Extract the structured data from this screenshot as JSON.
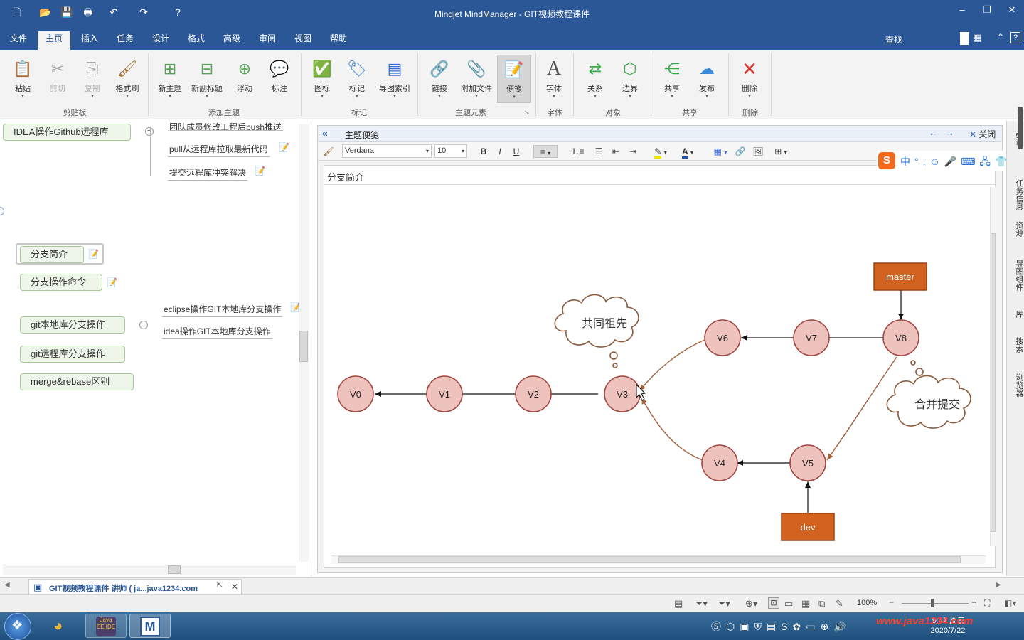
{
  "app": {
    "title": "Mindjet MindManager - GIT视频教程课件"
  },
  "menu": {
    "tabs": [
      "文件",
      "主页",
      "插入",
      "任务",
      "设计",
      "格式",
      "高级",
      "审阅",
      "视图",
      "帮助"
    ],
    "active": "主页",
    "find": "查找"
  },
  "ribbon": {
    "clipboard": {
      "paste": "粘贴",
      "cut": "剪切",
      "copy": "复制",
      "painter": "格式刷",
      "group": "剪贴板"
    },
    "add": {
      "new_topic": "新主题",
      "new_subtopic": "新副标题",
      "floating": "浮动",
      "callout": "标注",
      "group": "添加主题"
    },
    "markers": {
      "icon": "图标",
      "tag": "标记",
      "index": "导图索引",
      "group": "标记"
    },
    "elements": {
      "link": "链接",
      "attach": "附加文件",
      "notes": "便笺",
      "group": "主题元素"
    },
    "font": {
      "font": "字体",
      "group": "字体"
    },
    "objects": {
      "relation": "关系",
      "boundary": "边界",
      "group": "对象"
    },
    "share": {
      "share": "共享",
      "publish": "发布",
      "group": "共享"
    },
    "delete": {
      "delete": "删除",
      "group": "删除"
    }
  },
  "mindmap": {
    "root": "IDEA操作Github远程库",
    "root_children": [
      "团队成员修改工程后push推送",
      "pull从远程库拉取最新代码",
      "提交远程库冲突解决"
    ],
    "topics": [
      "分支简介",
      "分支操作命令",
      "git本地库分支操作",
      "git远程库分支操作",
      "merge&rebase区别"
    ],
    "local_children": [
      "eclipse操作GIT本地库分支操作",
      "idea操作GIT本地库分支操作"
    ]
  },
  "notes": {
    "header": "主题便笺",
    "close": "关闭",
    "font_name": "Verdana",
    "font_size": "10",
    "bold": "B",
    "italic": "I",
    "underline": "U",
    "body_title": "分支简介"
  },
  "diagram": {
    "nodes": [
      "V0",
      "V1",
      "V2",
      "V3",
      "V4",
      "V5",
      "V6",
      "V7",
      "V8"
    ],
    "branches": [
      "master",
      "dev"
    ],
    "clouds": [
      "共同祖先",
      "合并提交"
    ]
  },
  "dock": {
    "items": [
      "索引",
      "任务信息",
      "资源",
      "导图组件",
      "库",
      "搜索",
      "浏览器"
    ]
  },
  "doctab": {
    "label": "GIT视频教程课件 讲师 ( ja...java1234.com"
  },
  "status": {
    "zoom": "100%"
  },
  "taskbar": {
    "time": "9:47 周三",
    "date": "2020/7/22",
    "watermark": "www.java1234.com"
  },
  "colors": {
    "title_bar": "#2b5797",
    "node_fill": "#efc3bd",
    "node_border": "#a0453e",
    "box_fill": "#d1621f",
    "arrow": "#a0603a"
  }
}
